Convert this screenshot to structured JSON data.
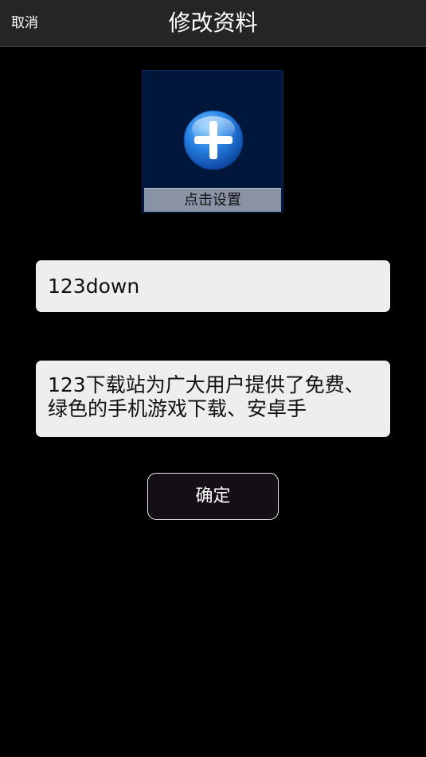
{
  "header": {
    "cancel_label": "取消",
    "title": "修改资料"
  },
  "avatar": {
    "icon": "plus-circle-icon",
    "caption": "点击设置"
  },
  "form": {
    "name_value": "123down",
    "bio_text": "123下载站为广大用户提供了免费、绿色的手机游戏下载、安卓手"
  },
  "actions": {
    "confirm_label": "确定"
  },
  "colors": {
    "background": "#000000",
    "header_bg": "#252525",
    "avatar_bg": "#00163a",
    "field_bg": "#eeeeee",
    "plus_blue": "#1f6fd6"
  }
}
